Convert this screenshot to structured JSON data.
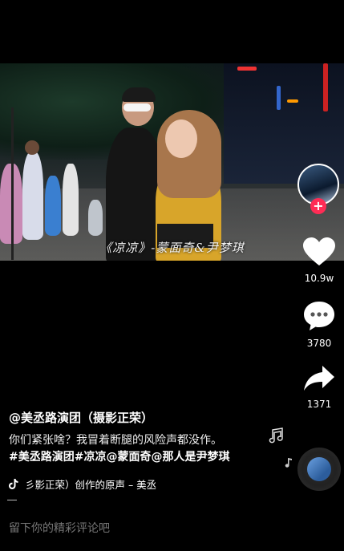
{
  "video": {
    "caption": "《凉凉》-蒙面奇&尹梦琪"
  },
  "sidebar": {
    "like_count": "10.9w",
    "comment_count": "3780",
    "share_count": "1371",
    "follow_symbol": "+"
  },
  "post": {
    "author": "@美丞路演团（摄影正荣）",
    "description": "你们紧张啥？我冒着断腿的风险声都没作。",
    "hashtags": "#美丞路演团#凉凉@蒙面奇@那人是尹梦琪",
    "music": "彡影正荣）创作的原声 – 美丞"
  },
  "comment": {
    "placeholder": "留下你的精彩评论吧"
  },
  "colors": {
    "background": "#000000",
    "accent": "#fe2c55",
    "comment_placeholder": "#777777"
  },
  "icons": [
    "heart-icon",
    "comment-icon",
    "share-icon",
    "music-note-icon",
    "tiktok-icon",
    "music-disc-icon",
    "plus-icon"
  ]
}
